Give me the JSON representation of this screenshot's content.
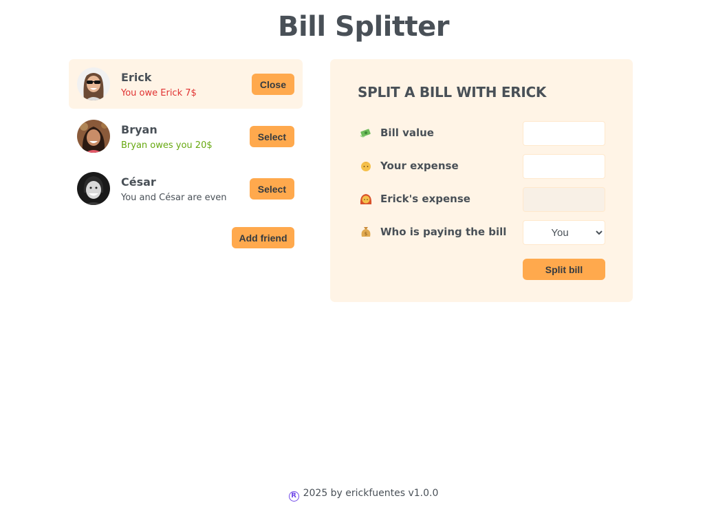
{
  "app": {
    "title": "Bill Splitter"
  },
  "friends": [
    {
      "name": "Erick",
      "status": "You owe Erick 7$",
      "button": "Close"
    },
    {
      "name": "Bryan",
      "status": "Bryan owes you 20$",
      "button": "Select"
    },
    {
      "name": "César",
      "status": "You and César are even",
      "button": "Select"
    }
  ],
  "add_friend_label": "Add friend",
  "split": {
    "title": "Split a bill with Erick",
    "bill_value_label": "Bill value",
    "bill_value": "",
    "your_expense_label": "Your expense",
    "your_expense": "",
    "friend_expense_label": "Erick's expense",
    "friend_expense": "",
    "payer_label": "Who is paying the bill",
    "payer_selected": "You",
    "submit_label": "Split bill"
  },
  "footer": {
    "symbol": "R",
    "text": "2025 by erickfuentes v1.0.0"
  },
  "colors": {
    "accent": "#ffa94d",
    "panel_bg": "#fff4e6",
    "owe_red": "#e03131",
    "owed_green": "#66a80f",
    "text": "#495057"
  },
  "icons": {
    "bill_value": "money-with-wings-icon",
    "your_expense": "person-icon",
    "friend_expense": "woman-red-hair-icon",
    "payer": "money-bag-icon",
    "footer": "registered-icon"
  }
}
